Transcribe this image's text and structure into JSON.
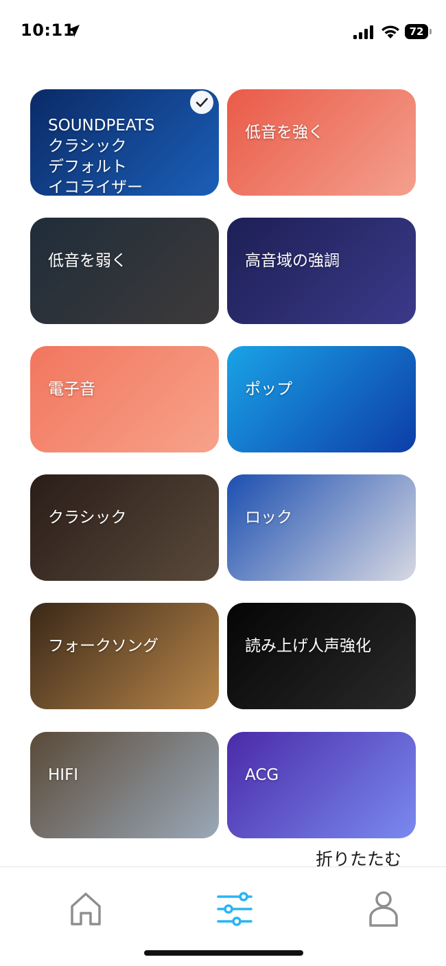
{
  "status_bar": {
    "time": "10:11",
    "battery": "72"
  },
  "presets": [
    {
      "label": "SOUNDPEATS\nクラシック\nデフォルト\nイコライザー",
      "selected": true,
      "colors": [
        "#0b2a66",
        "#1b5fb8"
      ]
    },
    {
      "label": "低音を強く",
      "selected": false,
      "colors": [
        "#ea5a48",
        "#f4a08e"
      ]
    },
    {
      "label": "低音を弱く",
      "selected": false,
      "colors": [
        "#1f2d3a",
        "#3e3a3a"
      ]
    },
    {
      "label": "高音域の強調",
      "selected": false,
      "colors": [
        "#1d1f55",
        "#3b3a8a"
      ]
    },
    {
      "label": "電子音",
      "selected": false,
      "colors": [
        "#f2765e",
        "#f7a28a"
      ]
    },
    {
      "label": "ポップ",
      "selected": false,
      "colors": [
        "#1aa3e6",
        "#0d3da8"
      ]
    },
    {
      "label": "クラシック",
      "selected": false,
      "colors": [
        "#2a1d18",
        "#5a4a3c"
      ]
    },
    {
      "label": "ロック",
      "selected": false,
      "colors": [
        "#1b4fb0",
        "#d8d8e2"
      ]
    },
    {
      "label": "フォークソング",
      "selected": false,
      "colors": [
        "#3a2818",
        "#b8864a"
      ]
    },
    {
      "label": "読み上げ人声強化",
      "selected": false,
      "colors": [
        "#050505",
        "#2a2a2a"
      ]
    },
    {
      "label": "HIFI",
      "selected": false,
      "colors": [
        "#5a4a38",
        "#9aa8b8"
      ]
    },
    {
      "label": "ACG",
      "selected": false,
      "colors": [
        "#4a2aa8",
        "#7a8af0"
      ]
    }
  ],
  "fold_label": "折りたたむ",
  "nav": {
    "active": "equalizer",
    "accent": "#27b5f4",
    "inactive": "#8e8e8e"
  }
}
